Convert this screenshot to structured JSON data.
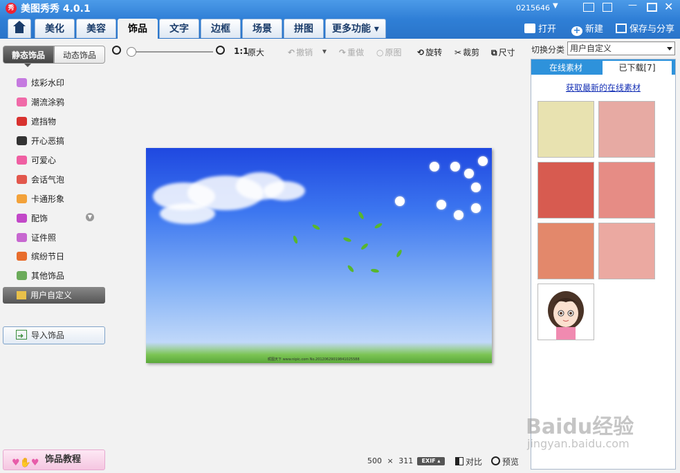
{
  "app": {
    "title": "美图秀秀 4.0.1",
    "logo_text": "秀",
    "user": "0215646"
  },
  "tabs": [
    {
      "label": "美化"
    },
    {
      "label": "美容"
    },
    {
      "label": "饰品"
    },
    {
      "label": "文字"
    },
    {
      "label": "边框"
    },
    {
      "label": "场景"
    },
    {
      "label": "拼图"
    },
    {
      "label": "更多功能 ▾"
    }
  ],
  "top_actions": {
    "open": "打开",
    "new": "新建",
    "save_share": "保存与分享"
  },
  "left": {
    "subtabs": {
      "static": "静态饰品",
      "dynamic": "动态饰品"
    },
    "categories": [
      {
        "label": "炫彩水印",
        "icon": "sparkle-icon",
        "color": "#c57ae0"
      },
      {
        "label": "潮流涂鸦",
        "icon": "lips-icon",
        "color": "#f06aa8"
      },
      {
        "label": "遮挡物",
        "icon": "mask-icon",
        "color": "#d8322f"
      },
      {
        "label": "开心恶搞",
        "icon": "funny-icon",
        "color": "#333333"
      },
      {
        "label": "可爱心",
        "icon": "heart-icon",
        "color": "#ef5fa2"
      },
      {
        "label": "会话气泡",
        "icon": "speech-bubble-icon",
        "color": "#e2574c"
      },
      {
        "label": "卡通形象",
        "icon": "cartoon-icon",
        "color": "#f3a23a"
      },
      {
        "label": "配饰",
        "icon": "bow-icon",
        "color": "#c248c8"
      },
      {
        "label": "证件照",
        "icon": "shirt-icon",
        "color": "#c767d0"
      },
      {
        "label": "缤纷节日",
        "icon": "gift-icon",
        "color": "#e86d2d"
      },
      {
        "label": "其他饰品",
        "icon": "star-icon",
        "color": "#6bab5a"
      }
    ],
    "user_defined": "用户自定义",
    "import": "导入饰品",
    "tutorial": "饰品教程"
  },
  "toolbar": {
    "ratio": "1:1",
    "original_size": "原大",
    "undo": "撤销",
    "redo": "重做",
    "original": "原图",
    "rotate": "旋转",
    "crop": "裁剪",
    "resize": "尺寸"
  },
  "image": {
    "watermark": "昵图天下 www.nipic.com  No.20120629019841025588"
  },
  "status": {
    "width": "500",
    "times": "×",
    "height": "311",
    "exif": "EXIF ▴",
    "compare": "对比",
    "preview": "预览"
  },
  "right": {
    "category_label": "切换分类",
    "category_value": "用户自定义",
    "tabs": {
      "online": "在线素材",
      "downloaded": "已下载[7]"
    },
    "link": "获取最新的在线素材"
  },
  "watermark": {
    "main": "Baidu经验",
    "sub": "jingyan.baidu.com"
  }
}
